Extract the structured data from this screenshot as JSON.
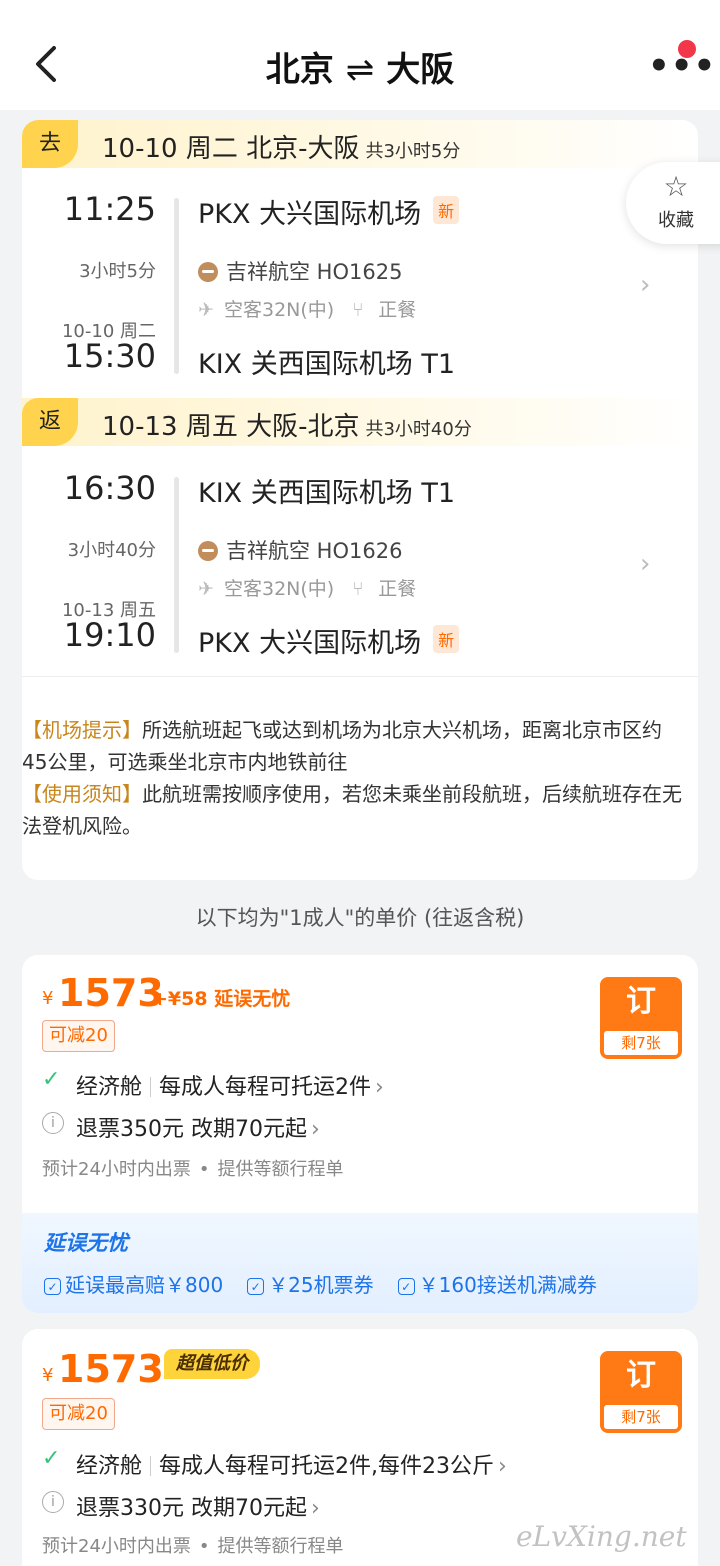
{
  "header": {
    "from": "北京",
    "arrow": "⇌",
    "to": "大阪"
  },
  "favorite": {
    "label": "收藏"
  },
  "outbound": {
    "tag": "去",
    "title": "10-10 周二 北京-大阪",
    "total_duration": "共3小时5分",
    "depart_time": "11:25",
    "depart_airport": "PKX 大兴国际机场",
    "depart_badge": "新",
    "duration": "3小时5分",
    "airline": "吉祥航空 HO1625",
    "aircraft": "空客32N(中)",
    "meal": "正餐",
    "arrive_date": "10-10 周二",
    "arrive_time": "15:30",
    "arrive_airport": "KIX 关西国际机场 T1"
  },
  "return": {
    "tag": "返",
    "title": "10-13 周五 大阪-北京",
    "total_duration": "共3小时40分",
    "depart_time": "16:30",
    "depart_airport": "KIX 关西国际机场 T1",
    "duration": "3小时40分",
    "airline": "吉祥航空 HO1626",
    "aircraft": "空客32N(中)",
    "meal": "正餐",
    "arrive_date": "10-13 周五",
    "arrive_time": "19:10",
    "arrive_airport": "PKX 大兴国际机场",
    "arrive_badge": "新"
  },
  "notices": {
    "airport_tip_label": "【机场提示】",
    "airport_tip_text": "所选航班起飞或达到机场为北京大兴机场，距离北京市区约45公里，可选乘坐北京市内地铁前往",
    "usage_label": "【使用须知】",
    "usage_text": "此航班需按顺序使用，若您未乘坐前段航班，后续航班存在无法登机风险。"
  },
  "price_note": "以下均为\"1成人\"的单价 (往返含税)",
  "offers": [
    {
      "currency": "¥",
      "price": "1573",
      "addon": "+¥58 延误无忧",
      "discount": "可减20",
      "book_label": "订",
      "remaining": "剩7张",
      "cabin": "经济舱",
      "baggage": "每成人每程可托运2件",
      "refund": "退票350元 改期70元起",
      "ticketing": "预计24小时内出票",
      "itinerary": "提供等额行程单",
      "delay": {
        "title": "延误无忧",
        "items": [
          "延误最高赔￥800",
          "￥25机票券",
          "￥160接送机满减券"
        ]
      }
    },
    {
      "currency": "¥",
      "price": "1573",
      "badge": "超值低价",
      "discount": "可减20",
      "book_label": "订",
      "remaining": "剩7张",
      "cabin": "经济舱",
      "baggage": "每成人每程可托运2件,每件23公斤",
      "refund": "退票330元 改期70元起",
      "ticketing": "预计24小时内出票",
      "itinerary": "提供等额行程单"
    }
  ],
  "watermark": "eLvXing.net",
  "icons": {
    "check": "✓",
    "info": "i",
    "chevron": "›",
    "star": "☆",
    "plane": "✈",
    "meal": "🍴",
    "more": "•••"
  },
  "colors": {
    "accent": "#ff6a00",
    "leg_tag": "#ffd34d",
    "delay_blue": "#1d73e8",
    "check_green": "#36c37a"
  }
}
